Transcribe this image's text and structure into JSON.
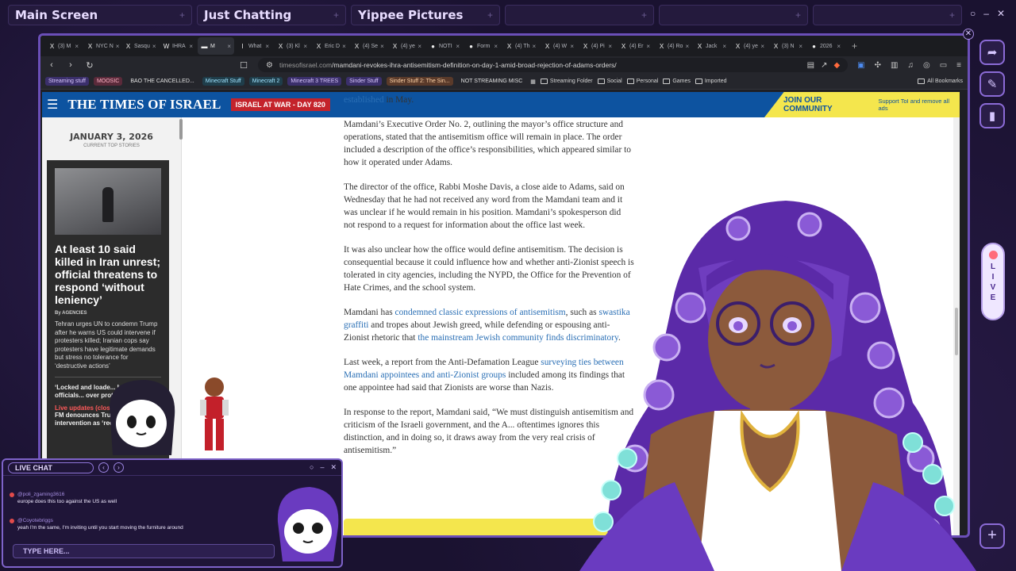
{
  "scene_tabs": [
    "Main Screen",
    "Just Chatting",
    "Yippee Pictures",
    "",
    "",
    ""
  ],
  "window_controls": [
    "○",
    "–",
    "✕"
  ],
  "browser_tabs": [
    {
      "icon": "X",
      "label": "(3) M"
    },
    {
      "icon": "X",
      "label": "NYC N"
    },
    {
      "icon": "X",
      "label": "Sasqu"
    },
    {
      "icon": "W",
      "label": "IHRA"
    },
    {
      "icon": "▬",
      "label": "M",
      "active": true
    },
    {
      "icon": "I",
      "label": "What"
    },
    {
      "icon": "X",
      "label": "(3) Kl"
    },
    {
      "icon": "X",
      "label": "Eric D"
    },
    {
      "icon": "X",
      "label": "(4) Se"
    },
    {
      "icon": "X",
      "label": "(4) ye"
    },
    {
      "icon": "●",
      "label": "NOTI"
    },
    {
      "icon": "●",
      "label": "Form"
    },
    {
      "icon": "X",
      "label": "(4) Th"
    },
    {
      "icon": "X",
      "label": "(4) W"
    },
    {
      "icon": "X",
      "label": "(4) Pi"
    },
    {
      "icon": "X",
      "label": "(4) Er"
    },
    {
      "icon": "X",
      "label": "(4) Ro"
    },
    {
      "icon": "X",
      "label": "Jack"
    },
    {
      "icon": "X",
      "label": "(4) ye"
    },
    {
      "icon": "X",
      "label": "(3) N"
    },
    {
      "icon": "●",
      "label": "2026"
    }
  ],
  "url": {
    "domain": "timesofisrael.com",
    "path": "/mamdani-revokes-ihra-antisemitism-definition-on-day-1-amid-broad-rejection-of-adams-orders/"
  },
  "bookmarks": [
    {
      "label": "Streaming stuff",
      "bg": "#3b2f6b",
      "fg": "#d9c8ff"
    },
    {
      "label": "MOOSIC",
      "bg": "#5a2a3a",
      "fg": "#ffb3c6"
    },
    {
      "label": "BAO THE CANCELLED...",
      "bg": "transparent",
      "fg": "#e0e0e0"
    },
    {
      "label": "Minecraft Stuff",
      "bg": "#1f3d4a",
      "fg": "#9fe3ff"
    },
    {
      "label": "Minecraft 2",
      "bg": "#1f3d4a",
      "fg": "#9fe3ff"
    },
    {
      "label": "Minecraft 3 TREES",
      "bg": "#3b2f6b",
      "fg": "#d9c8ff"
    },
    {
      "label": "Sinder Stuff",
      "bg": "#3b2f6b",
      "fg": "#d9c8ff"
    },
    {
      "label": "Sinder Stuff 2: The Sin...",
      "bg": "#5a3a2a",
      "fg": "#ffd2a6"
    },
    {
      "label": "NOT STREAMING MISC",
      "bg": "transparent",
      "fg": "#e0e0e0"
    }
  ],
  "bookmark_folders": [
    "Streaming Folder",
    "Social",
    "Personal",
    "Games",
    "Imported"
  ],
  "all_bookmarks": "All Bookmarks",
  "site": {
    "logo": "THE TIMES OF ISRAEL",
    "badge": "ISRAEL AT WAR - DAY 820",
    "join_title": "JOIN OUR COMMUNITY",
    "join_sub": "Support ToI and remove all ads"
  },
  "sidebar": {
    "date": "JANUARY 3, 2026",
    "sub": "CURRENT TOP STORIES",
    "headline": "At least 10 said killed in Iran unrest; official threatens to respond ‘without leniency’",
    "byline": "By AGENCIES",
    "body": "Tehran urges UN to condemn Trump after he warns US could intervene if protesters killed; Iranian cops say protesters have legitimate demands but stress no tolerance for ‘destructive actions’",
    "item2": "‘Locked and loade... Iranian officials... over protests",
    "live": "Live updates (closed)",
    "item3": "FM denounces Trump... intervention as ‘reckle..."
  },
  "article": {
    "p0_link": "established",
    "p0_rest": " in May.",
    "p1": "Mamdani’s Executive Order No. 2, outlining the mayor’s office structure and operations, stated that the antisemitism office will remain in place. The order included a description of the office’s responsibilities, which appeared similar to how it operated under Adams.",
    "p2": "The director of the office, Rabbi Moshe Davis, a close aide to Adams, said on Wednesday that he had not received any word from the Mamdani team and it was unclear if he would remain in his position. Mamdani’s spokesperson did not respond to a request for information about the office last week.",
    "p3": "It was also unclear how the office would define antisemitism. The decision is consequential because it could influence how and whether anti-Zionist speech is tolerated in city agencies, including the NYPD, the Office for the Prevention of Hate Crimes, and the school system.",
    "p4_a": "Mamdani has ",
    "p4_link1": "condemned classic expressions of antisemitism",
    "p4_b": ", such as ",
    "p4_link2": "swastika graffiti",
    "p4_c": " and tropes about Jewish greed, while defending or espousing anti-Zionist rhetoric that ",
    "p4_link3": "the mainstream Jewish community finds discriminatory",
    "p4_d": ".",
    "p5_a": "Last week, a report from the Anti-Defamation League ",
    "p5_link": "surveying ties between Mamdani appointees and anti-Zionist groups",
    "p5_b": " included among its findings that one appointee had said that Zionists are worse than Nazis.",
    "p6": "In response to the report, Mamdani said, “We must distinguish antisemitism and criticism of the Israeli government, and the A... oftentimes ignores this distinction, and in doing so, it draws away from the very real crisis of antisemitism.”"
  },
  "right_buttons": [
    "share-icon",
    "feather-icon",
    "bookmark-icon"
  ],
  "live_label": "LIVE",
  "chat": {
    "title": "LIVE CHAT",
    "controls": [
      "○",
      "–",
      "✕"
    ],
    "messages": [
      {
        "user": "@poli_zgaming3616",
        "text": "europe does this too against the US as well"
      },
      {
        "user": "@Coyotebriggs",
        "text": "yeah I'm the same, I'm inviting until you start moving the furniture around"
      }
    ],
    "input_placeholder": "TYPE HERE..."
  },
  "colors": {
    "accent": "#7e63c9",
    "toi_blue": "#0d53a0",
    "toi_yellow": "#f4e64d",
    "toi_red": "#c4232b",
    "link": "#2a6fb5"
  }
}
